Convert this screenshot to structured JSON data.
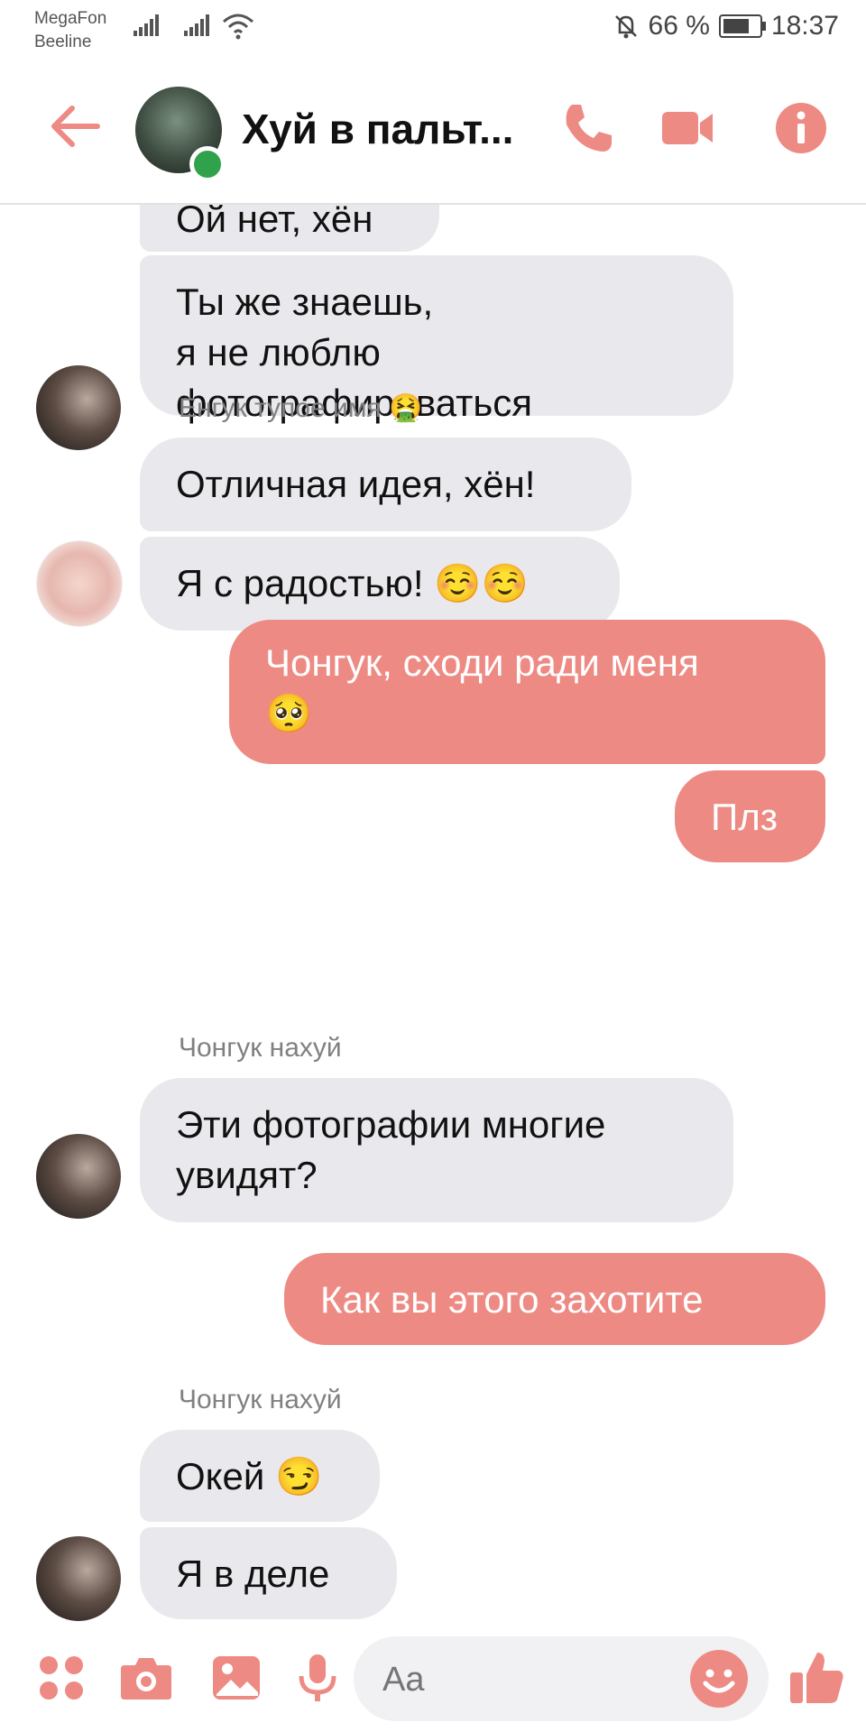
{
  "status_bar": {
    "carrier_1": "MegaFon",
    "carrier_2": "Beeline",
    "battery": "66 %",
    "time": "18:37"
  },
  "header": {
    "title": "Хуй в пальт...",
    "accent_color": "#ee8a84",
    "icons": [
      "back-arrow-icon",
      "phone-icon",
      "video-camera-icon",
      "info-icon"
    ]
  },
  "messages": [
    {
      "side": "in",
      "text": "Ой нет, хён"
    },
    {
      "side": "in",
      "text_lines": [
        "Ты же знаешь,",
        "я не люблю",
        "фотографироваться"
      ]
    },
    {
      "side": "in",
      "sender": "Енгук тупое имя 🤮",
      "text": "Отличная идея, хён!"
    },
    {
      "side": "in",
      "text": "Я с радостью! ☺️☺️"
    },
    {
      "side": "out",
      "text_lines": [
        "Чонгук, сходи ради меня",
        "🥺"
      ]
    },
    {
      "side": "out",
      "text": "Плз"
    },
    {
      "side": "in",
      "sender": "Чонгук нахуй",
      "text_lines": [
        "Эти фотографии многие",
        "увидят?"
      ]
    },
    {
      "side": "out",
      "text": "Как вы этого захотите"
    },
    {
      "side": "in",
      "sender": "Чонгук нахуй",
      "text": "Окей 😏"
    },
    {
      "side": "in",
      "text": "Я в деле"
    }
  ],
  "composer": {
    "placeholder": "Aa",
    "icons": [
      "apps-icon",
      "camera-icon",
      "gallery-icon",
      "microphone-icon",
      "emoji-icon",
      "thumbs-up-icon"
    ]
  }
}
